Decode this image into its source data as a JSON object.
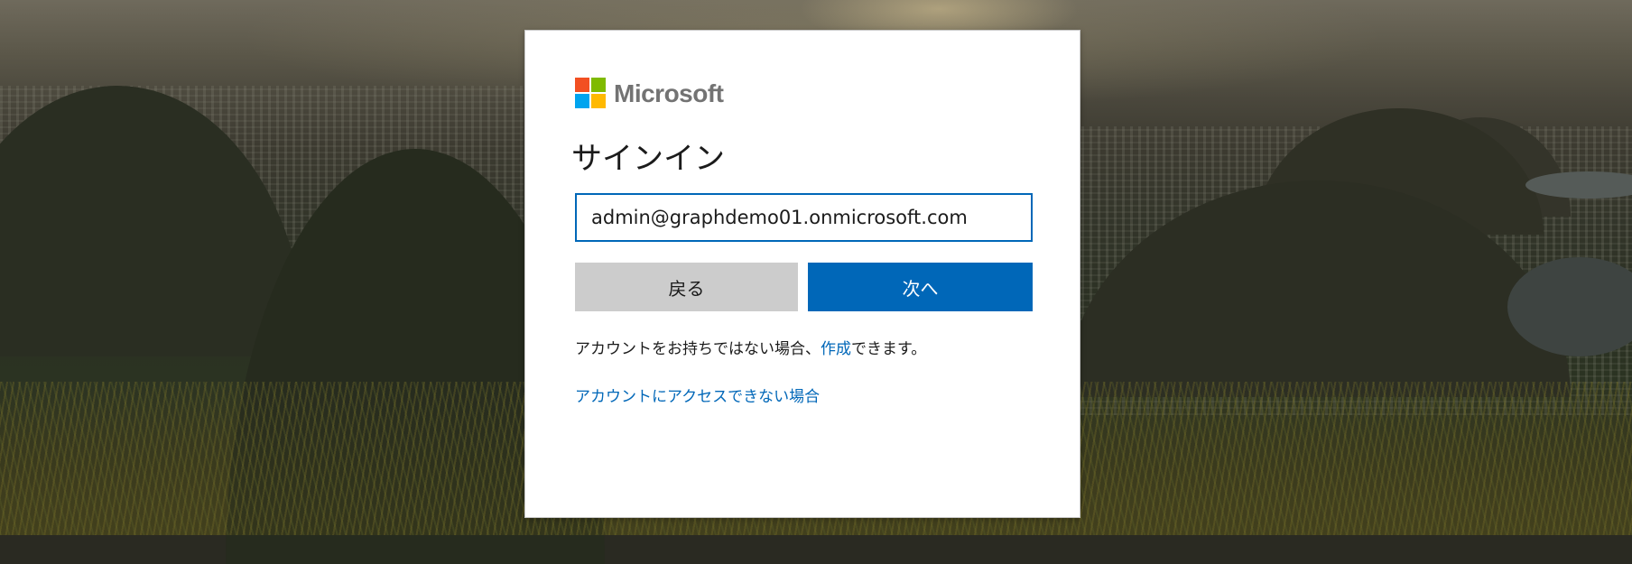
{
  "brand": {
    "name": "Microsoft",
    "squares": [
      "#f25022",
      "#7fba00",
      "#00a4ef",
      "#ffb900"
    ]
  },
  "signin": {
    "title": "サインイン",
    "email_value": "admin@graphdemo01.onmicrosoft.com",
    "back_label": "戻る",
    "next_label": "次へ",
    "no_account_prefix": "アカウントをお持ちではない場合、",
    "create_link": "作成",
    "no_account_suffix": "できます。",
    "cant_access_link": "アカウントにアクセスできない場合"
  },
  "colors": {
    "accent": "#0067b8",
    "back_button": "#cccccc",
    "logo_text": "#737373"
  }
}
